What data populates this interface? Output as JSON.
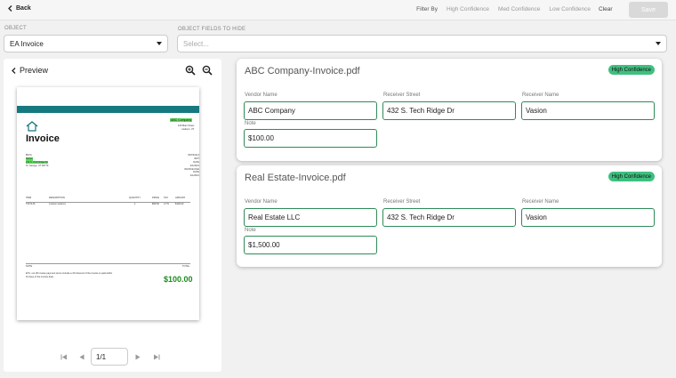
{
  "topbar": {
    "back_label": "Back",
    "filter_label": "Filter By",
    "filters": [
      "High Confidence",
      "Med Confidence",
      "Low Confidence"
    ],
    "clear_label": "Clear",
    "save_label": "Save"
  },
  "object": {
    "label": "OBJECT",
    "value": "EA Invoice"
  },
  "fields_to_hide": {
    "label": "OBJECT FIELDS TO HIDE",
    "placeholder": "Select..."
  },
  "preview": {
    "title": "Preview",
    "doc": {
      "heading": "Invoice",
      "company": "ABC Company",
      "address_lines": [
        "100 Main Street",
        "Hudson, UT"
      ],
      "bill_to": [
        "Bill To",
        "Vasion",
        "432 S. Tech Ridge Dr",
        "St. George, UT 84770"
      ],
      "meta_lines": [
        "INVOICE #",
        "0007",
        "DATE",
        "4/1/2021",
        "INVOICE DUE DATE",
        "4/1/2021"
      ],
      "table_headers": [
        "ITEM",
        "DESCRIPTION",
        "QUANTITY",
        "PRICE",
        "TAX",
        "AMOUNT"
      ],
      "table_row": [
        "T2471JS",
        "Custom weberry",
        "1",
        "$95.50",
        "4.7%",
        "$100.00"
      ],
      "notes_label": "NOTE",
      "notes_text": "ETC, net 30 invoice payment terms include a 2% discount if the invoice is paid within 10 days of the invoice date.",
      "total_label": "TOTAL",
      "total_value": "$100.00"
    },
    "page_value": "1/1",
    "pager_icons": [
      "first-page-icon",
      "prev-page-icon",
      "next-page-icon",
      "last-page-icon"
    ]
  },
  "cards": [
    {
      "title": "ABC Company-Invoice.pdf",
      "badge": "High Confidence",
      "vendor_name_label": "Vendor Name",
      "vendor_name": "ABC Company",
      "receiver_street_label": "Receiver Street",
      "receiver_street": "432 S. Tech Ridge Dr",
      "receiver_name_label": "Receiver Name",
      "receiver_name": "Vasion",
      "note_label": "Note",
      "note": "$100.00"
    },
    {
      "title": "Real Estate-Invoice.pdf",
      "badge": "High Confidence",
      "vendor_name_label": "Vendor Name",
      "vendor_name": "Real Estate LLC",
      "receiver_street_label": "Receiver Street",
      "receiver_street": "432 S. Tech Ridge Dr",
      "receiver_name_label": "Receiver Name",
      "receiver_name": "Vasion",
      "note_label": "Note",
      "note": "$1,500.00"
    }
  ],
  "colors": {
    "teal": "#16797f",
    "badge_green": "#3fbf7f",
    "field_border": "#2f8a58",
    "highlight": "#5fdc5f"
  }
}
